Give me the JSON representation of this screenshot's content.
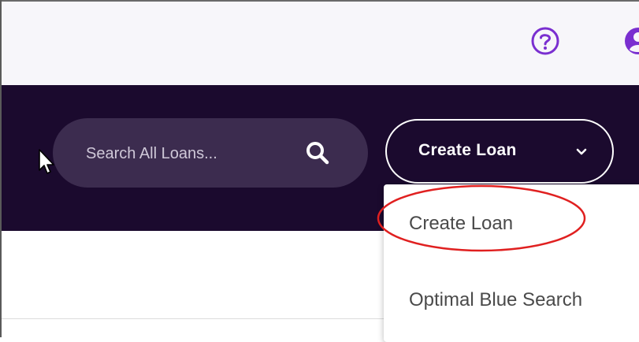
{
  "header": {
    "help_icon": "help-circle-icon",
    "account_icon": "account-circle-icon",
    "accent_color": "#7a2fd0"
  },
  "navbar": {
    "background": "#1b0a2e",
    "search": {
      "placeholder": "Search All Loans...",
      "icon": "search-icon"
    },
    "create_loan_button": {
      "label": "Create Loan",
      "icon": "chevron-down-icon"
    }
  },
  "dropdown": {
    "items": [
      {
        "label": "Create Loan",
        "highlighted": true
      },
      {
        "label": "Optimal Blue Search",
        "highlighted": false
      }
    ],
    "highlight_color": "#e02020"
  }
}
